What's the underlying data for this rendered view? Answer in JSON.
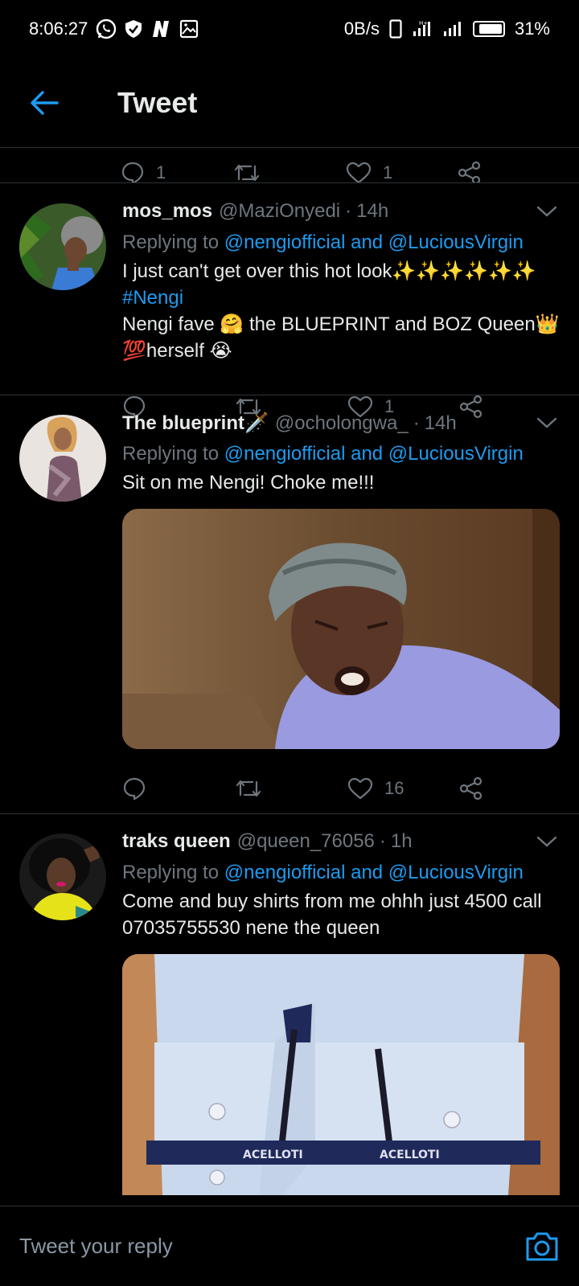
{
  "status_bar": {
    "time": "8:06:27",
    "network_speed": "0B/s",
    "battery": "31%",
    "battery_level": 0.31
  },
  "header": {
    "title": "Tweet"
  },
  "prev_tweet": {
    "reply_count": "1",
    "like_count": "1"
  },
  "tweets": [
    {
      "name": "mos_mos",
      "handle": "@MaziOnyedi",
      "separator": "·",
      "time": "14h",
      "replying_prefix": "Replying to",
      "replying_to": "@nengiofficial and @LuciousVirgin",
      "text_before_tag": "I just can't get over this hot look✨✨✨✨✨✨ ",
      "hashtag": "#Nengi",
      "text_after_tag": "Nengi fave 🤗 the BLUEPRINT and BOZ Queen👑 💯herself 😭",
      "reply_count": "",
      "like_count": "1"
    },
    {
      "name": "The blueprint🗡️",
      "handle": "@ocholongwa_",
      "separator": "·",
      "time": "14h",
      "replying_prefix": "Replying to",
      "replying_to": "@nengiofficial and @LuciousVirgin",
      "text": "Sit on me Nengi! Choke me!!!",
      "reply_count": "",
      "like_count": "16"
    },
    {
      "name": "traks queen",
      "handle": "@queen_76056",
      "separator": "·",
      "time": "1h",
      "replying_prefix": "Replying to",
      "replying_to": "@nengiofficial and @LuciousVirgin",
      "text": "Come and buy shirts from me ohhh just 4500 call 07035755530 nene the queen",
      "image_brand": "ACELLOTI"
    }
  ],
  "compose": {
    "placeholder": "Tweet your reply"
  },
  "colors": {
    "accent": "#1d9bf0",
    "background": "#000000",
    "muted": "#6e767d"
  }
}
